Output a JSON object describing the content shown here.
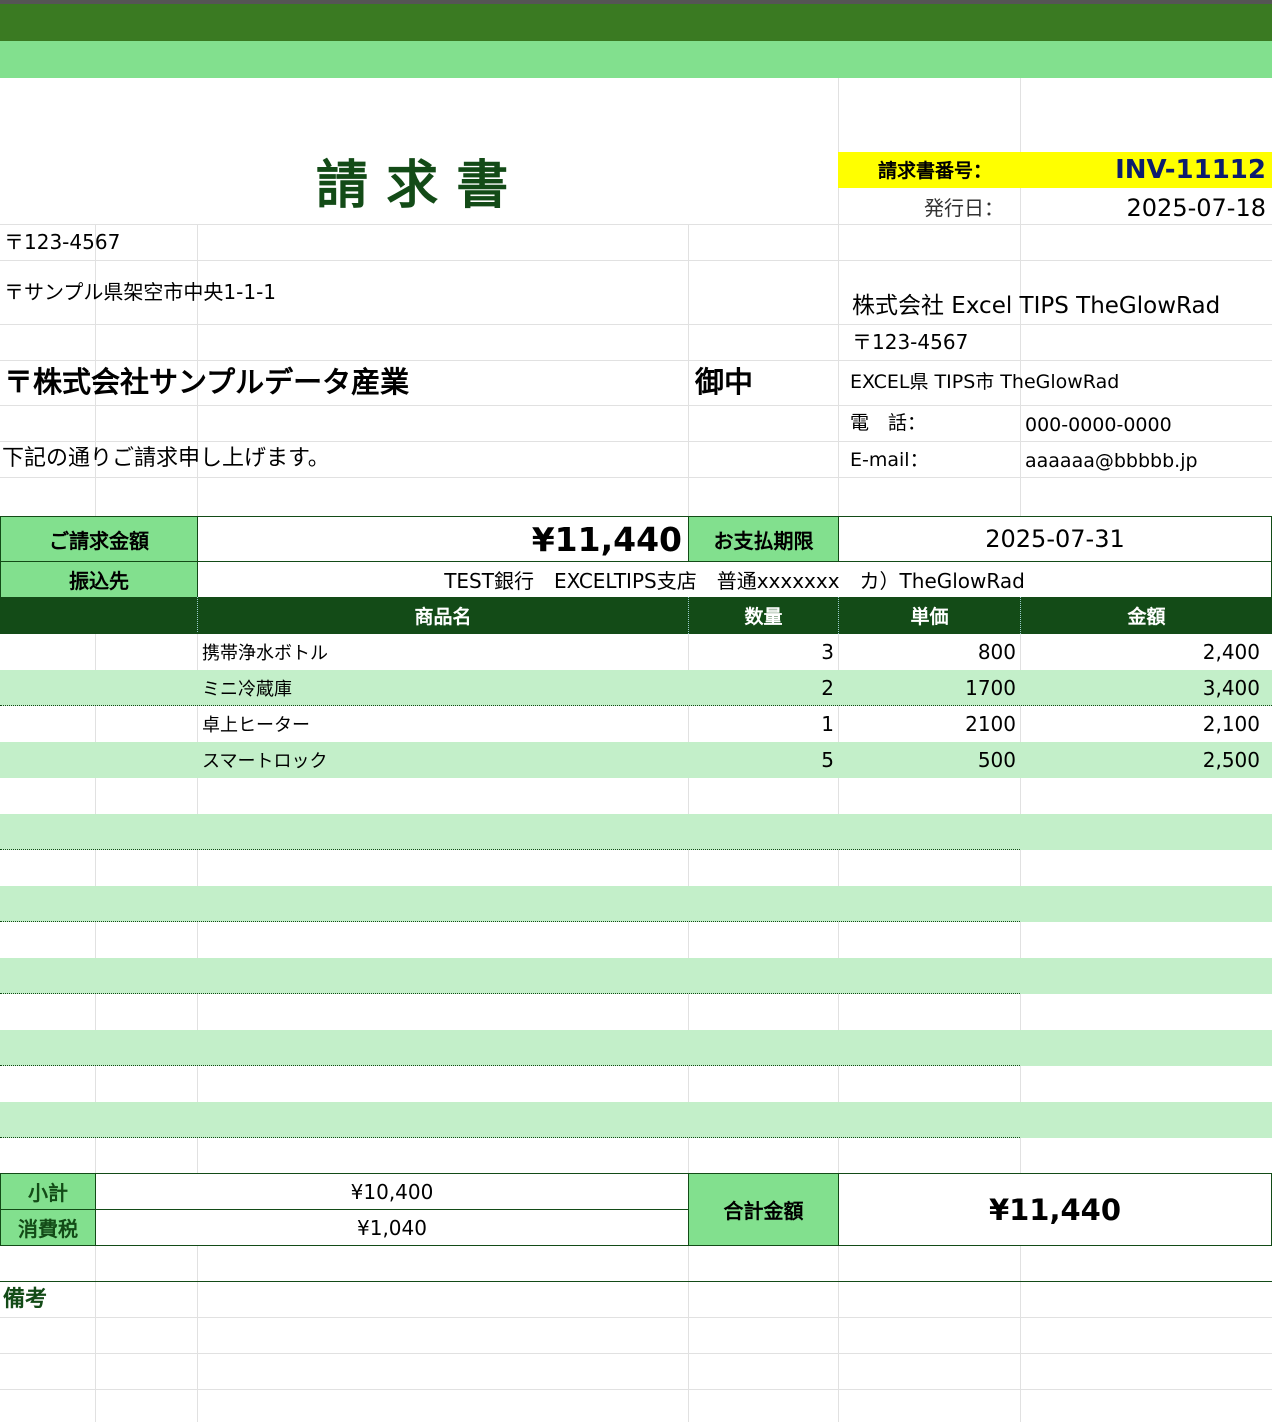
{
  "invoice": {
    "title": "請 求 書",
    "number_label": "請求書番号：",
    "number": "INV-11112",
    "issue_label": "発行日：",
    "issue_date": "2025-07-18"
  },
  "recipient": {
    "postal": "〒123-4567",
    "address": "〒サンプル県架空市中央1-1-1",
    "company": "〒株式会社サンプルデータ産業",
    "honorific": "御中",
    "greeting": "下記の通りご請求申し上げます。"
  },
  "sender": {
    "company": "株式会社 Excel TIPS TheGlowRad",
    "postal": "〒123-4567",
    "address": "EXCEL県 TIPS市 TheGlowRad",
    "phone_label": "電　話：",
    "phone": "000-0000-0000",
    "email_label": "E-mail：",
    "email": "aaaaaa@bbbbb.jp"
  },
  "summary": {
    "amount_label": "ご請求金額",
    "amount": "¥11,440",
    "due_label": "お支払期限",
    "due_date": "2025-07-31",
    "bank_label": "振込先",
    "bank": "TEST銀行　EXCELTIPS支店　普通xxxxxxx　カ）TheGlowRad"
  },
  "table": {
    "headers": {
      "name": "商品名",
      "qty": "数量",
      "price": "単価",
      "amount": "金額"
    },
    "rows": [
      {
        "name": "携帯浄水ボトル",
        "qty": "3",
        "price": "800",
        "amount": "2,400"
      },
      {
        "name": "ミニ冷蔵庫",
        "qty": "2",
        "price": "1700",
        "amount": "3,400"
      },
      {
        "name": "卓上ヒーター",
        "qty": "1",
        "price": "2100",
        "amount": "2,100"
      },
      {
        "name": "スマートロック",
        "qty": "5",
        "price": "500",
        "amount": "2,500"
      }
    ]
  },
  "totals": {
    "subtotal_label": "小計",
    "subtotal": "¥10,400",
    "tax_label": "消費税",
    "tax": "¥1,040",
    "total_label": "合計金額",
    "total": "¥11,440"
  },
  "notes": {
    "label": "備考"
  },
  "colors": {
    "header_dark": "#3a7a22",
    "header_light": "#82e08e",
    "table_header": "#134b17",
    "stripe": "#c3efc9",
    "highlight": "#ffff00"
  }
}
